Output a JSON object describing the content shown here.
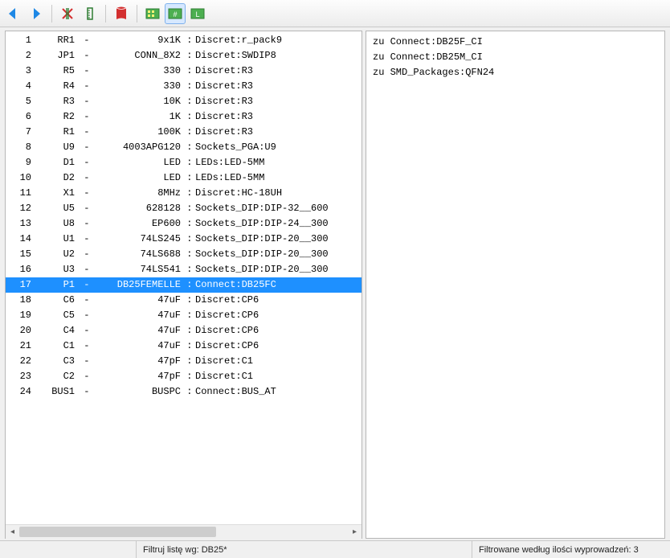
{
  "toolbar": {
    "back": "back",
    "forward": "forward",
    "edit_red": "edit",
    "ruler": "ruler",
    "pdf": "pdf",
    "view1": "view-grid-1",
    "view2": "view-grid-2",
    "view3": "view-grid-3"
  },
  "components": [
    {
      "idx": "1",
      "ref": "RR1",
      "val": "9x1K",
      "fp": "Discret:r_pack9",
      "sel": false
    },
    {
      "idx": "2",
      "ref": "JP1",
      "val": "CONN_8X2",
      "fp": "Discret:SWDIP8",
      "sel": false
    },
    {
      "idx": "3",
      "ref": "R5",
      "val": "330",
      "fp": "Discret:R3",
      "sel": false
    },
    {
      "idx": "4",
      "ref": "R4",
      "val": "330",
      "fp": "Discret:R3",
      "sel": false
    },
    {
      "idx": "5",
      "ref": "R3",
      "val": "10K",
      "fp": "Discret:R3",
      "sel": false
    },
    {
      "idx": "6",
      "ref": "R2",
      "val": "1K",
      "fp": "Discret:R3",
      "sel": false
    },
    {
      "idx": "7",
      "ref": "R1",
      "val": "100K",
      "fp": "Discret:R3",
      "sel": false
    },
    {
      "idx": "8",
      "ref": "U9",
      "val": "4003APG120",
      "fp": "Sockets_PGA:U9",
      "sel": false
    },
    {
      "idx": "9",
      "ref": "D1",
      "val": "LED",
      "fp": "LEDs:LED-5MM",
      "sel": false
    },
    {
      "idx": "10",
      "ref": "D2",
      "val": "LED",
      "fp": "LEDs:LED-5MM",
      "sel": false
    },
    {
      "idx": "11",
      "ref": "X1",
      "val": "8MHz",
      "fp": "Discret:HC-18UH",
      "sel": false
    },
    {
      "idx": "12",
      "ref": "U5",
      "val": "628128",
      "fp": "Sockets_DIP:DIP-32__600",
      "sel": false
    },
    {
      "idx": "13",
      "ref": "U8",
      "val": "EP600",
      "fp": "Sockets_DIP:DIP-24__300",
      "sel": false
    },
    {
      "idx": "14",
      "ref": "U1",
      "val": "74LS245",
      "fp": "Sockets_DIP:DIP-20__300",
      "sel": false
    },
    {
      "idx": "15",
      "ref": "U2",
      "val": "74LS688",
      "fp": "Sockets_DIP:DIP-20__300",
      "sel": false
    },
    {
      "idx": "16",
      "ref": "U3",
      "val": "74LS541",
      "fp": "Sockets_DIP:DIP-20__300",
      "sel": false
    },
    {
      "idx": "17",
      "ref": "P1",
      "val": "DB25FEMELLE",
      "fp": "Connect:DB25FC",
      "sel": true
    },
    {
      "idx": "18",
      "ref": "C6",
      "val": "47uF",
      "fp": "Discret:CP6",
      "sel": false
    },
    {
      "idx": "19",
      "ref": "C5",
      "val": "47uF",
      "fp": "Discret:CP6",
      "sel": false
    },
    {
      "idx": "20",
      "ref": "C4",
      "val": "47uF",
      "fp": "Discret:CP6",
      "sel": false
    },
    {
      "idx": "21",
      "ref": "C1",
      "val": "47uF",
      "fp": "Discret:CP6",
      "sel": false
    },
    {
      "idx": "22",
      "ref": "C3",
      "val": "47pF",
      "fp": "Discret:C1",
      "sel": false
    },
    {
      "idx": "23",
      "ref": "C2",
      "val": "47pF",
      "fp": "Discret:C1",
      "sel": false
    },
    {
      "idx": "24",
      "ref": "BUS1",
      "val": "BUSPC",
      "fp": "Connect:BUS_AT",
      "sel": false
    }
  ],
  "row_dash": "-",
  "row_sep": ":",
  "footprints": [
    {
      "prefix": "zu ",
      "name": "Connect:DB25F_CI"
    },
    {
      "prefix": "zu ",
      "name": "Connect:DB25M_CI"
    },
    {
      "prefix": "zu ",
      "name": "SMD_Packages:QFN24"
    }
  ],
  "status": {
    "cell1": "",
    "cell2": "Filtruj listę wg: DB25*",
    "cell3": "Filtrowane według ilości wyprowadzeń: 3"
  }
}
